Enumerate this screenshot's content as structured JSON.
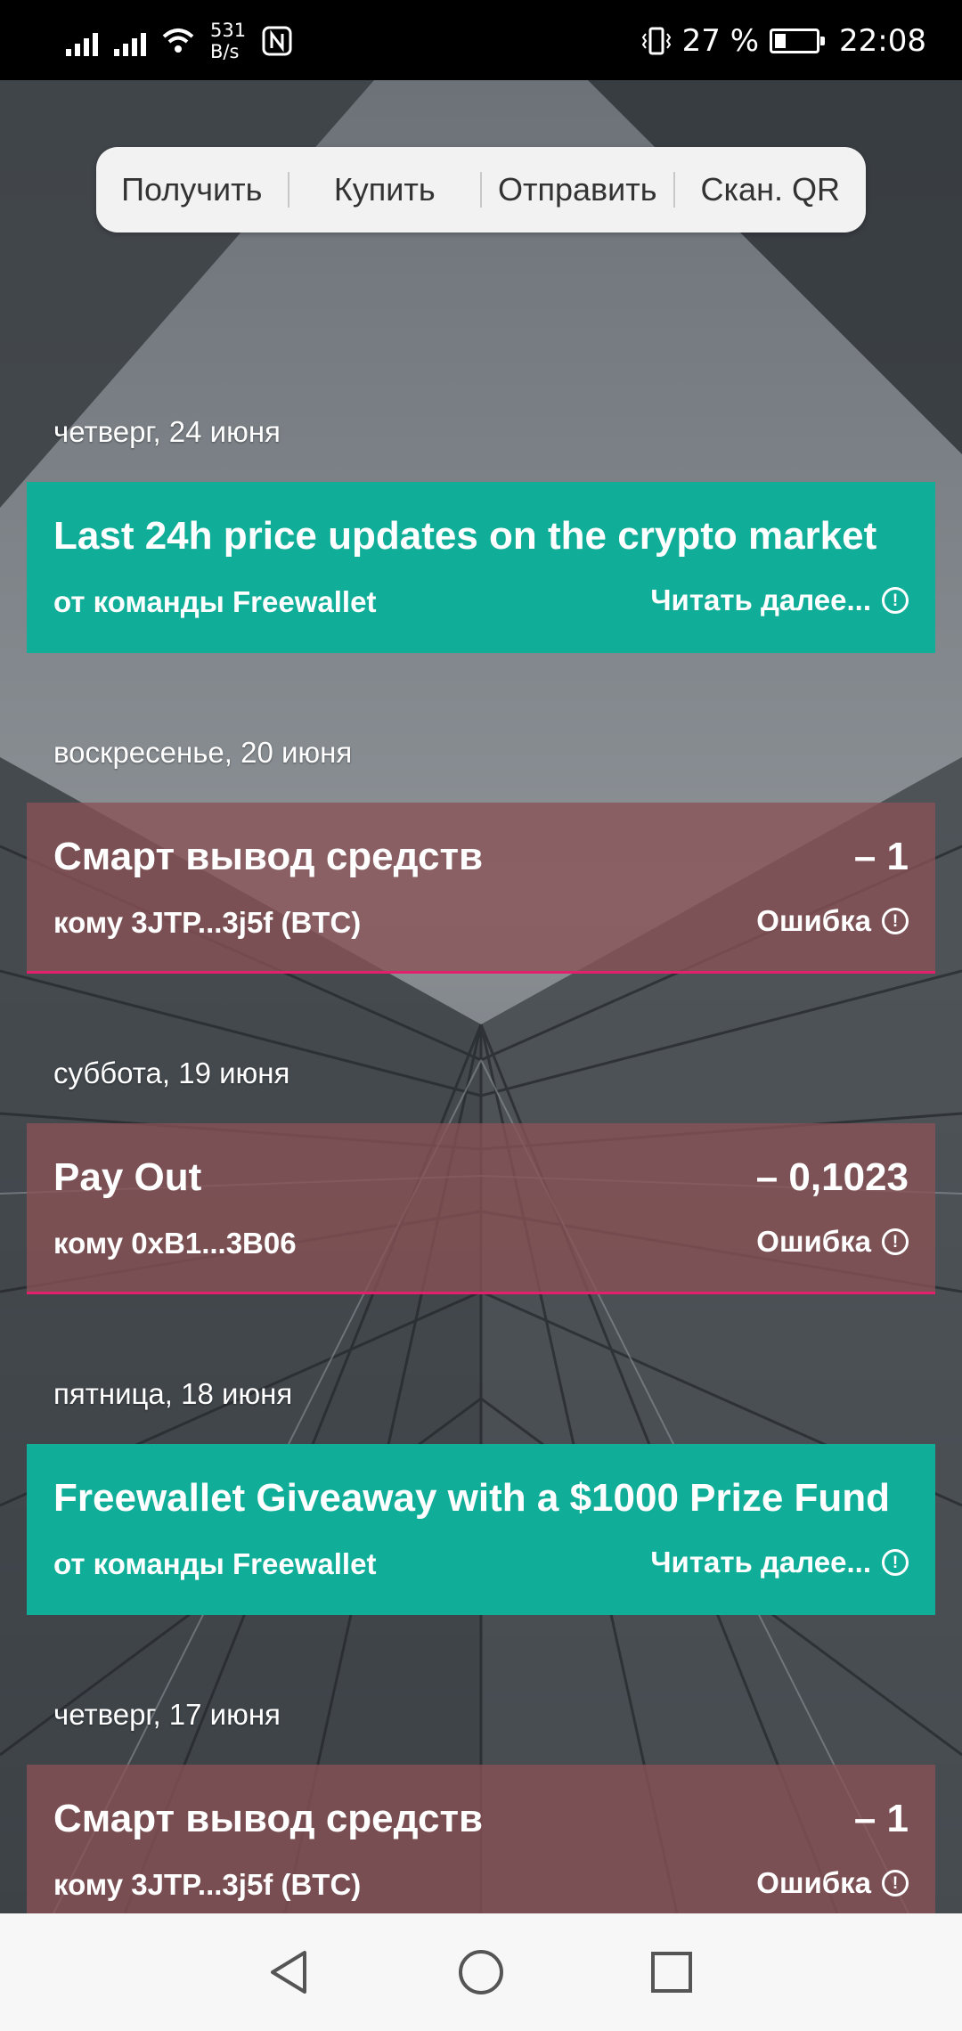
{
  "status_bar": {
    "net_speed_value": "531",
    "net_speed_unit": "B/s",
    "battery_percent": "27 %",
    "battery_level": 0.27,
    "time": "22:08",
    "icons": [
      "signal-icon",
      "signal-icon",
      "wifi-icon",
      "nfc-icon",
      "vibrate-icon",
      "battery-icon"
    ]
  },
  "actions": {
    "receive": "Получить",
    "buy": "Купить",
    "send": "Отправить",
    "scan_qr": "Скан. QR"
  },
  "feed": [
    {
      "date": "четверг, 24 июня",
      "type": "news",
      "title": "Last 24h price updates on the crypto market",
      "subtitle": "от команды Freewallet",
      "status": "Читать далее..."
    },
    {
      "date": "воскресенье, 20 июня",
      "type": "tx",
      "title": "Смарт вывод средств",
      "amount": "– 1",
      "subtitle": "кому 3JTP...3j5f (BTC)",
      "status": "Ошибка"
    },
    {
      "date": "суббота, 19 июня",
      "type": "tx",
      "title": "Pay Out",
      "amount": "– 0,1023",
      "subtitle": "кому 0xB1...3B06",
      "status": "Ошибка"
    },
    {
      "date": "пятница, 18 июня",
      "type": "news",
      "title": "Freewallet Giveaway with a $1000 Prize Fund",
      "subtitle": "от команды Freewallet",
      "status": "Читать далее..."
    },
    {
      "date": "четверг, 17 июня",
      "type": "tx",
      "title": "Смарт вывод средств",
      "amount": "– 1",
      "subtitle": "кому 3JTP...3j5f (BTC)",
      "status": "Ошибка"
    }
  ],
  "info_glyph": "!",
  "colors": {
    "news_card": "#10ae98",
    "tx_card": "#8a5256",
    "tx_error_line": "#e2206b"
  }
}
